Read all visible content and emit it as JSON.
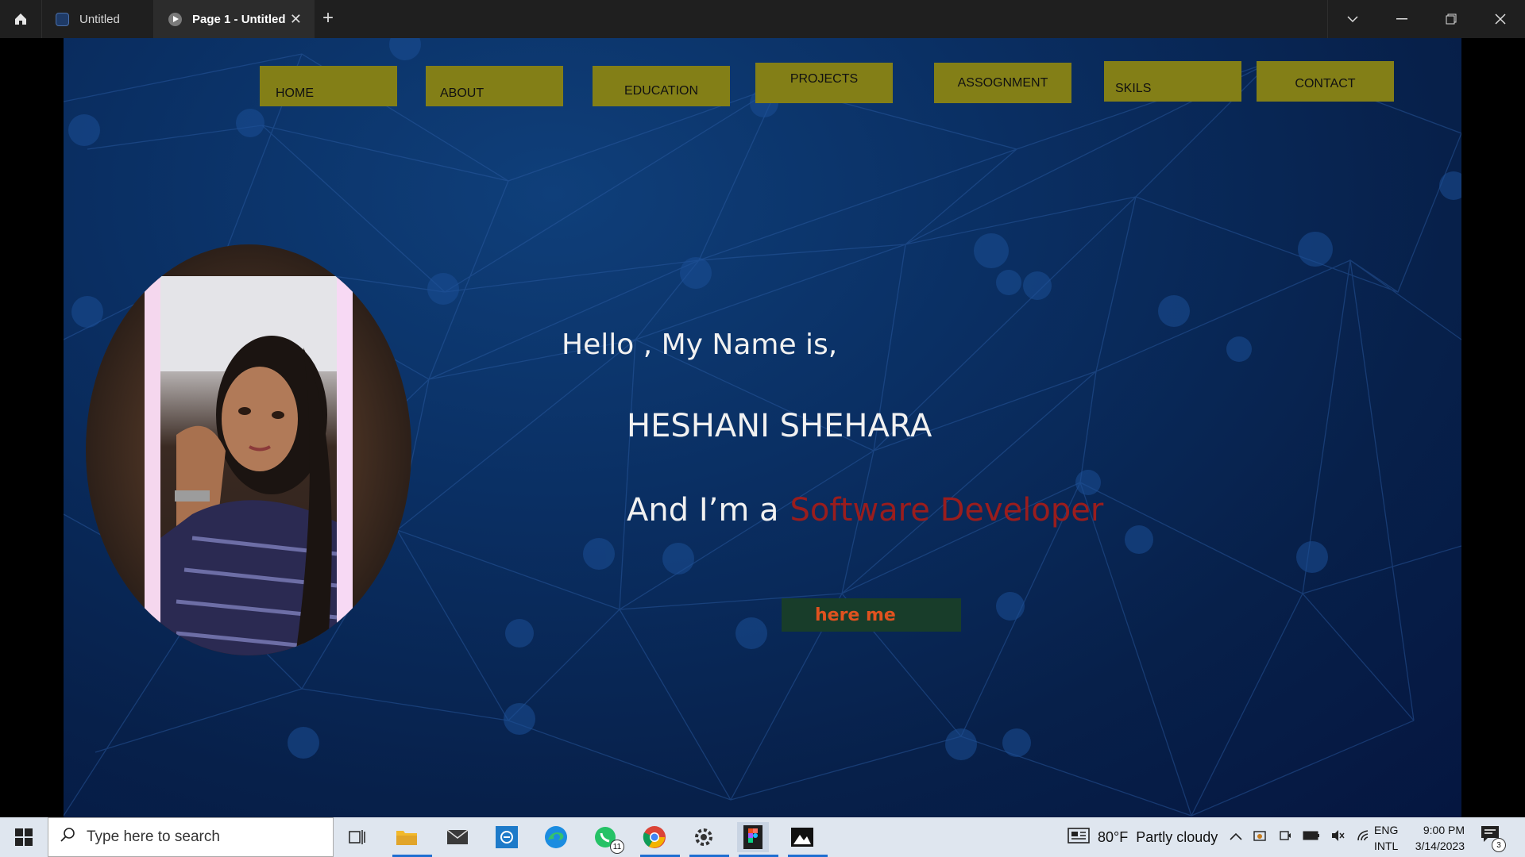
{
  "titlebar": {
    "tabs": [
      {
        "label": "Untitled",
        "active": false
      },
      {
        "label": "Page 1 - Untitled",
        "active": true
      }
    ],
    "close_tab_glyph": "✕",
    "new_tab_glyph": "+",
    "window_controls": [
      "chevron-down",
      "minimize",
      "restore",
      "close"
    ]
  },
  "site": {
    "nav": [
      "HOME",
      "ABOUT",
      "EDUCATION",
      "PROJECTS",
      "ASSOGNMENT",
      "SKILS",
      "CONTACT"
    ],
    "nav_color": "#837f17",
    "greeting": "Hello  , My Name is,",
    "name": "HESHANI SHEHARA",
    "role_prefix": "And  I’m a",
    "role_accent": "Software Developer",
    "accent_color": "#9a1d1d",
    "cta_label": "here me",
    "cta_text_color": "#e0521f",
    "background_color": "#0a2f63"
  },
  "taskbar": {
    "search_placeholder": "Type here to search",
    "apps": [
      "task-view",
      "file-explorer",
      "mail",
      "app-blue",
      "edge",
      "whatsapp",
      "chrome",
      "settings",
      "figma",
      "photos"
    ],
    "whatsapp_badge": "11",
    "weather_temp": "80°F",
    "weather_text": "Partly cloudy",
    "lang_top": "ENG",
    "lang_bottom": "INTL",
    "time": "9:00 PM",
    "date": "3/14/2023",
    "notification_count": "3"
  }
}
